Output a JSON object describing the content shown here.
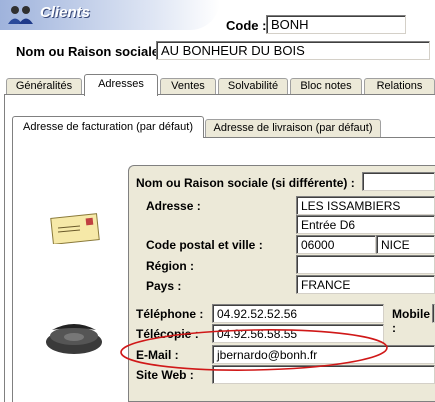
{
  "window": {
    "title": "Clients"
  },
  "header": {
    "code_label": "Code :",
    "code_value": "BONH",
    "name_label": "Nom ou Raison sociale :",
    "name_value": "AU BONHEUR DU BOIS"
  },
  "tabs": [
    {
      "label": "Généralités"
    },
    {
      "label": "Adresses"
    },
    {
      "label": "Ventes"
    },
    {
      "label": "Solvabilité"
    },
    {
      "label": "Bloc notes"
    },
    {
      "label": "Relations"
    }
  ],
  "subtabs": [
    {
      "label": "Adresse de facturation (par défaut)"
    },
    {
      "label": "Adresse de livraison (par défaut)"
    }
  ],
  "address": {
    "alt_name_label": "Nom ou Raison sociale (si différente) :",
    "alt_name_value": "",
    "adresse_label": "Adresse :",
    "adresse_line1": "LES ISSAMBIERS",
    "adresse_line2": "Entrée D6",
    "cp_label": "Code postal et ville :",
    "cp_value": "06000",
    "ville_value": "NICE",
    "region_label": "Région :",
    "region_value": "",
    "pays_label": "Pays :",
    "pays_value": "FRANCE"
  },
  "contact": {
    "telephone_label": "Téléphone :",
    "telephone_value": "04.92.52.52.56",
    "mobile_label": "Mobile :",
    "telecopie_label": "Télécopie :",
    "telecopie_value": "04.92.56.58.55",
    "email_label": "E-Mail :",
    "email_value": "jbernardo@bonh.fr",
    "siteweb_label": "Site Web :",
    "siteweb_value": ""
  },
  "colors": {
    "title_bar": "#b8c8e8",
    "highlight_ellipse": "#d01818",
    "panel_bg": "#ece9d8"
  },
  "icons": [
    "users-icon",
    "envelope-icon",
    "telephone-icon"
  ]
}
